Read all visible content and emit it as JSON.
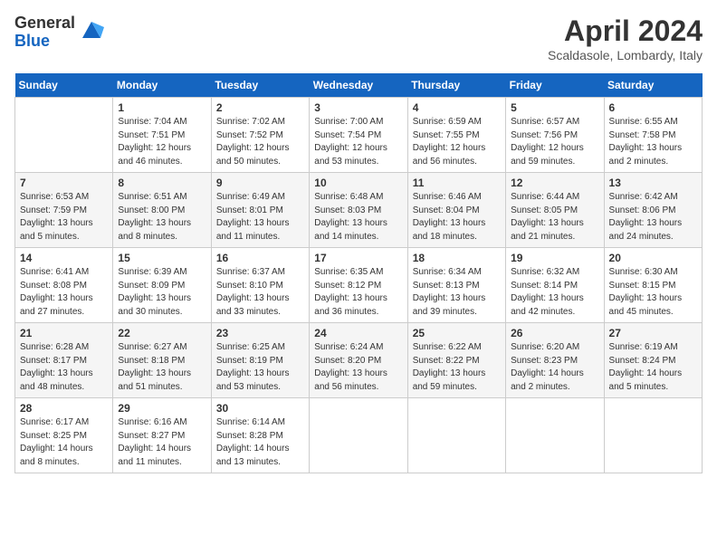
{
  "logo": {
    "general": "General",
    "blue": "Blue"
  },
  "title": "April 2024",
  "location": "Scaldasole, Lombardy, Italy",
  "days_of_week": [
    "Sunday",
    "Monday",
    "Tuesday",
    "Wednesday",
    "Thursday",
    "Friday",
    "Saturday"
  ],
  "weeks": [
    [
      {
        "day": "",
        "sunrise": "",
        "sunset": "",
        "daylight": ""
      },
      {
        "day": "1",
        "sunrise": "Sunrise: 7:04 AM",
        "sunset": "Sunset: 7:51 PM",
        "daylight": "Daylight: 12 hours and 46 minutes."
      },
      {
        "day": "2",
        "sunrise": "Sunrise: 7:02 AM",
        "sunset": "Sunset: 7:52 PM",
        "daylight": "Daylight: 12 hours and 50 minutes."
      },
      {
        "day": "3",
        "sunrise": "Sunrise: 7:00 AM",
        "sunset": "Sunset: 7:54 PM",
        "daylight": "Daylight: 12 hours and 53 minutes."
      },
      {
        "day": "4",
        "sunrise": "Sunrise: 6:59 AM",
        "sunset": "Sunset: 7:55 PM",
        "daylight": "Daylight: 12 hours and 56 minutes."
      },
      {
        "day": "5",
        "sunrise": "Sunrise: 6:57 AM",
        "sunset": "Sunset: 7:56 PM",
        "daylight": "Daylight: 12 hours and 59 minutes."
      },
      {
        "day": "6",
        "sunrise": "Sunrise: 6:55 AM",
        "sunset": "Sunset: 7:58 PM",
        "daylight": "Daylight: 13 hours and 2 minutes."
      }
    ],
    [
      {
        "day": "7",
        "sunrise": "Sunrise: 6:53 AM",
        "sunset": "Sunset: 7:59 PM",
        "daylight": "Daylight: 13 hours and 5 minutes."
      },
      {
        "day": "8",
        "sunrise": "Sunrise: 6:51 AM",
        "sunset": "Sunset: 8:00 PM",
        "daylight": "Daylight: 13 hours and 8 minutes."
      },
      {
        "day": "9",
        "sunrise": "Sunrise: 6:49 AM",
        "sunset": "Sunset: 8:01 PM",
        "daylight": "Daylight: 13 hours and 11 minutes."
      },
      {
        "day": "10",
        "sunrise": "Sunrise: 6:48 AM",
        "sunset": "Sunset: 8:03 PM",
        "daylight": "Daylight: 13 hours and 14 minutes."
      },
      {
        "day": "11",
        "sunrise": "Sunrise: 6:46 AM",
        "sunset": "Sunset: 8:04 PM",
        "daylight": "Daylight: 13 hours and 18 minutes."
      },
      {
        "day": "12",
        "sunrise": "Sunrise: 6:44 AM",
        "sunset": "Sunset: 8:05 PM",
        "daylight": "Daylight: 13 hours and 21 minutes."
      },
      {
        "day": "13",
        "sunrise": "Sunrise: 6:42 AM",
        "sunset": "Sunset: 8:06 PM",
        "daylight": "Daylight: 13 hours and 24 minutes."
      }
    ],
    [
      {
        "day": "14",
        "sunrise": "Sunrise: 6:41 AM",
        "sunset": "Sunset: 8:08 PM",
        "daylight": "Daylight: 13 hours and 27 minutes."
      },
      {
        "day": "15",
        "sunrise": "Sunrise: 6:39 AM",
        "sunset": "Sunset: 8:09 PM",
        "daylight": "Daylight: 13 hours and 30 minutes."
      },
      {
        "day": "16",
        "sunrise": "Sunrise: 6:37 AM",
        "sunset": "Sunset: 8:10 PM",
        "daylight": "Daylight: 13 hours and 33 minutes."
      },
      {
        "day": "17",
        "sunrise": "Sunrise: 6:35 AM",
        "sunset": "Sunset: 8:12 PM",
        "daylight": "Daylight: 13 hours and 36 minutes."
      },
      {
        "day": "18",
        "sunrise": "Sunrise: 6:34 AM",
        "sunset": "Sunset: 8:13 PM",
        "daylight": "Daylight: 13 hours and 39 minutes."
      },
      {
        "day": "19",
        "sunrise": "Sunrise: 6:32 AM",
        "sunset": "Sunset: 8:14 PM",
        "daylight": "Daylight: 13 hours and 42 minutes."
      },
      {
        "day": "20",
        "sunrise": "Sunrise: 6:30 AM",
        "sunset": "Sunset: 8:15 PM",
        "daylight": "Daylight: 13 hours and 45 minutes."
      }
    ],
    [
      {
        "day": "21",
        "sunrise": "Sunrise: 6:28 AM",
        "sunset": "Sunset: 8:17 PM",
        "daylight": "Daylight: 13 hours and 48 minutes."
      },
      {
        "day": "22",
        "sunrise": "Sunrise: 6:27 AM",
        "sunset": "Sunset: 8:18 PM",
        "daylight": "Daylight: 13 hours and 51 minutes."
      },
      {
        "day": "23",
        "sunrise": "Sunrise: 6:25 AM",
        "sunset": "Sunset: 8:19 PM",
        "daylight": "Daylight: 13 hours and 53 minutes."
      },
      {
        "day": "24",
        "sunrise": "Sunrise: 6:24 AM",
        "sunset": "Sunset: 8:20 PM",
        "daylight": "Daylight: 13 hours and 56 minutes."
      },
      {
        "day": "25",
        "sunrise": "Sunrise: 6:22 AM",
        "sunset": "Sunset: 8:22 PM",
        "daylight": "Daylight: 13 hours and 59 minutes."
      },
      {
        "day": "26",
        "sunrise": "Sunrise: 6:20 AM",
        "sunset": "Sunset: 8:23 PM",
        "daylight": "Daylight: 14 hours and 2 minutes."
      },
      {
        "day": "27",
        "sunrise": "Sunrise: 6:19 AM",
        "sunset": "Sunset: 8:24 PM",
        "daylight": "Daylight: 14 hours and 5 minutes."
      }
    ],
    [
      {
        "day": "28",
        "sunrise": "Sunrise: 6:17 AM",
        "sunset": "Sunset: 8:25 PM",
        "daylight": "Daylight: 14 hours and 8 minutes."
      },
      {
        "day": "29",
        "sunrise": "Sunrise: 6:16 AM",
        "sunset": "Sunset: 8:27 PM",
        "daylight": "Daylight: 14 hours and 11 minutes."
      },
      {
        "day": "30",
        "sunrise": "Sunrise: 6:14 AM",
        "sunset": "Sunset: 8:28 PM",
        "daylight": "Daylight: 14 hours and 13 minutes."
      },
      {
        "day": "",
        "sunrise": "",
        "sunset": "",
        "daylight": ""
      },
      {
        "day": "",
        "sunrise": "",
        "sunset": "",
        "daylight": ""
      },
      {
        "day": "",
        "sunrise": "",
        "sunset": "",
        "daylight": ""
      },
      {
        "day": "",
        "sunrise": "",
        "sunset": "",
        "daylight": ""
      }
    ]
  ]
}
